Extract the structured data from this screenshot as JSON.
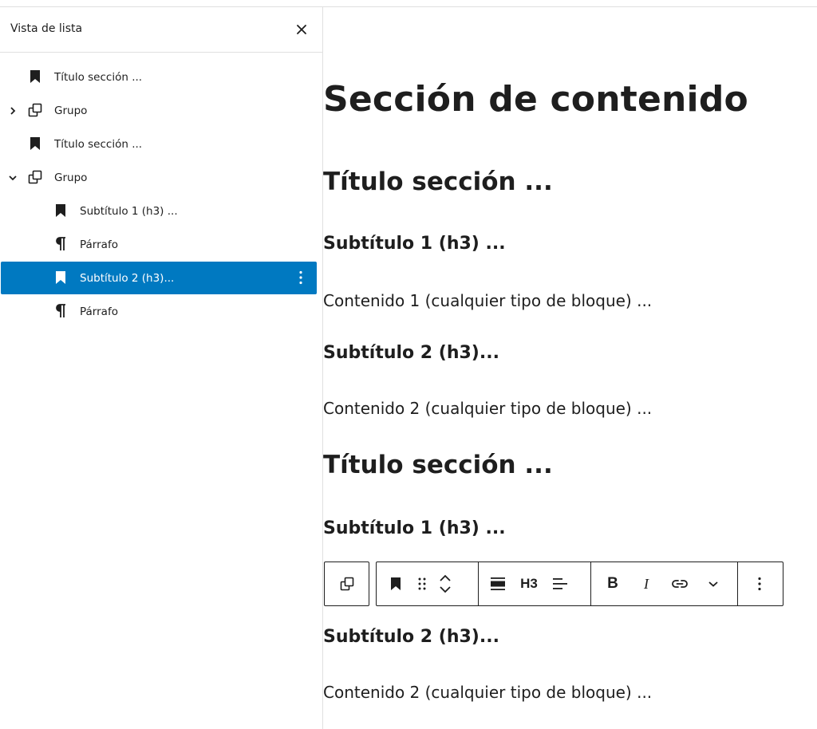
{
  "list_view": {
    "title": "Vista de lista",
    "close_icon": "close-icon",
    "items": [
      {
        "label": "Título sección ...",
        "icon": "bookmark-icon",
        "level": 1,
        "expander": "none",
        "selected": false
      },
      {
        "label": "Grupo",
        "icon": "group-icon",
        "level": 1,
        "expander": "collapsed",
        "selected": false
      },
      {
        "label": "Título sección ...",
        "icon": "bookmark-icon",
        "level": 1,
        "expander": "none",
        "selected": false
      },
      {
        "label": "Grupo",
        "icon": "group-icon",
        "level": 1,
        "expander": "expanded",
        "selected": false
      },
      {
        "label": "Subtítulo 1 (h3) ...",
        "icon": "bookmark-icon",
        "level": 2,
        "expander": "none",
        "selected": false
      },
      {
        "label": "Párrafo",
        "icon": "paragraph-icon",
        "level": 2,
        "expander": "none",
        "selected": false
      },
      {
        "label": "Subtítulo 2 (h3)...",
        "icon": "bookmark-icon",
        "level": 2,
        "expander": "none",
        "selected": true
      },
      {
        "label": "Párrafo",
        "icon": "paragraph-icon",
        "level": 2,
        "expander": "none",
        "selected": false
      }
    ]
  },
  "canvas": {
    "h1": "Sección de contenido",
    "s1_title": "Título sección ...",
    "s1_sub1": "Subtítulo 1 (h3) ...",
    "s1_p1": "Contenido 1 (cualquier tipo de bloque) ...",
    "s1_sub2": "Subtítulo 2 (h3)...",
    "s1_p2": "Contenido 2 (cualquier tipo de bloque) ...",
    "s2_title": "Título sección ...",
    "s2_sub1": "Subtítulo 1 (h3) ...",
    "s2_sub2": "Subtítulo 2 (h3)...",
    "s2_p2": "Contenido 2 (cualquier tipo de bloque) ..."
  },
  "toolbar": {
    "heading_level": "H3",
    "bold": "B",
    "italic": "I"
  },
  "colors": {
    "selected_bg": "#0079c1",
    "text": "#1e1e1e",
    "border": "#e0e0e0"
  }
}
